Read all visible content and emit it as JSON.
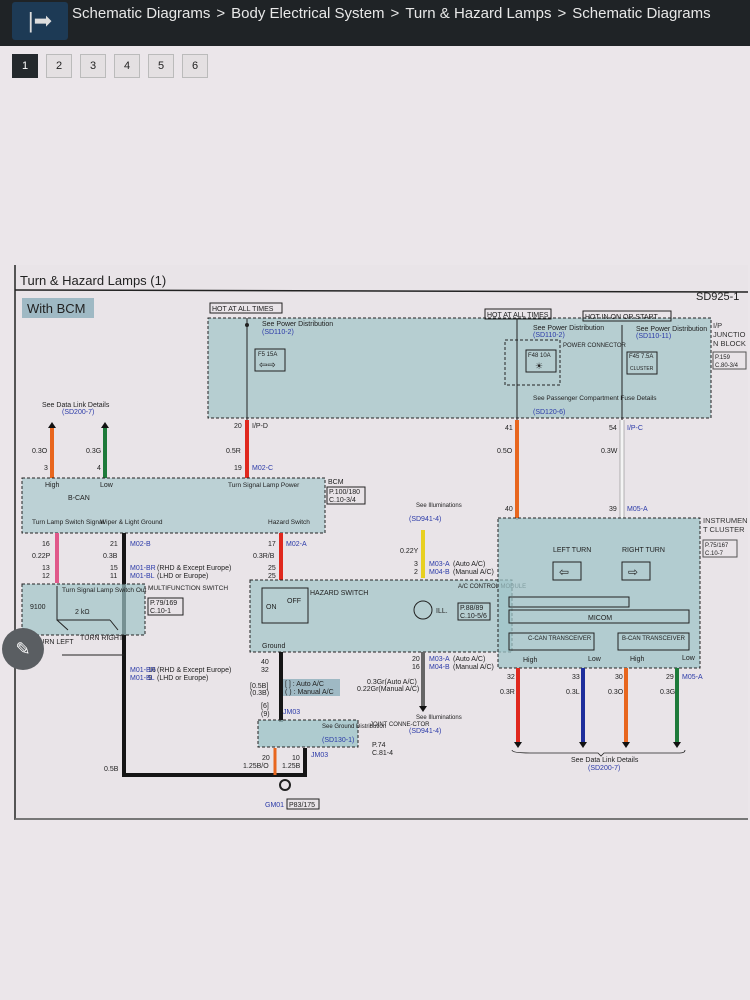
{
  "header": {
    "breadcrumbs": [
      "Schematic Diagrams",
      "Body Electrical System",
      "Turn & Hazard Lamps",
      "Schematic Diagrams"
    ],
    "separator": ">",
    "menu_icon": "arrow-right-bar-icon"
  },
  "pager": {
    "pages": [
      "1",
      "2",
      "3",
      "4",
      "5",
      "6"
    ],
    "active": "1"
  },
  "diagram": {
    "title": "Turn & Hazard Lamps (1)",
    "code": "SD925-1",
    "variant": "With BCM",
    "hot_all_times": "HOT AT ALL TIMES",
    "hot_on_start": "HOT IN ON OR START",
    "see_power_dist": "See Power Distribution",
    "sd110_2": "(SD110-2)",
    "sd110_11": "(SD110-11)",
    "fuse_f5": "F5 15A",
    "fuse_f48": "F48 10A",
    "fuse_f45": "F45 7.5A",
    "cluster_fuse_label": "CLUSTER",
    "power_connector": "POWER CONNECTOR",
    "see_passenger": "See Passenger Compartment Fuse Details",
    "sd120_6": "(SD120-6)",
    "ip_junction": "I/P JUNCTION BLOCK",
    "ip_junction_ref": [
      "P.159",
      "C.80-3/4"
    ],
    "see_data_link": "See Data Link Details",
    "sd200_7": "(SD200-7)",
    "wires": {
      "w_03o": "0.3O",
      "w_03g": "0.3G",
      "pin3": "3",
      "pin4": "4",
      "p20": "20",
      "ipd": "I/P-D",
      "w05r": "0.5R",
      "p19": "19",
      "m02c": "M02-C",
      "p41": "41",
      "w05o": "0.5O",
      "p54": "54",
      "ipc": "I/P-C",
      "w03w": "0.3W",
      "p40": "40",
      "p39": "39",
      "m05a": "M05-A",
      "p16": "16",
      "w022p": "0.22P",
      "p13": "13",
      "p12": "12",
      "p21": "21",
      "m02b": "M02-B",
      "w03b": "0.3B",
      "p15": "15",
      "p11": "11",
      "m01br": "M01-BR",
      "rhd": "(RHD & Except Europe)",
      "m01bl": "M01-BL",
      "lhd": "(LHD or Europe)",
      "p16b": "16",
      "p9": "9",
      "p17": "17",
      "m02a": "M02-A",
      "w03rb": "0.3R/B",
      "p25a": "25",
      "p25b": "25",
      "p40b": "40",
      "p32": "32",
      "w05b_br": "[0.5B]",
      "w03b_par": "(0.3B)",
      "legend_auto": "[ ] : Auto A/C",
      "legend_manual": "( ) : Manual A/C",
      "p6": "[6]",
      "p9b": "(9)",
      "jm03": "JM03",
      "p20b": "20",
      "w125bo": "1.25B/O",
      "p10": "10",
      "w125b": "1.25B",
      "jm03b": "JM03",
      "w05b": "0.5B",
      "w022y": "0.22Y",
      "p3": "3",
      "p2": "2",
      "m03a": "M03-A",
      "auto_ac": "(Auto A/C)",
      "m04b": "M04-B",
      "manual_ac": "(Manual A/C)",
      "p20c": "20",
      "p16c": "16",
      "w03gr": "0.3Gr(Auto A/C)",
      "w022gr": "0.22Gr(Manual A/C)",
      "p32b": "32",
      "w03r": "0.3R",
      "p33": "33",
      "w03l": "0.3L",
      "p30": "30",
      "w03o2": "0.3O",
      "p29": "29",
      "w03g2": "0.3G",
      "m05a2": "M05-A"
    },
    "bcm": {
      "name": "BCM",
      "ref": [
        "P.100/180",
        "C.10-3/4"
      ],
      "high": "High",
      "low": "Low",
      "bcan": "B-CAN",
      "turn_power": "Turn Signal Lamp Power",
      "turn_switch_signal": "Turn Lamp Switch Signal",
      "wiper_ground": "Wiper & Light Ground",
      "hazard_switch": "Hazard Switch"
    },
    "multifunction": {
      "name": "MULTIFUNCTION SWITCH",
      "ref": [
        "P.79/169",
        "C.10-1"
      ],
      "out": "Turn Signal Lamp Switch Out",
      "r1": "9100",
      "r2": "2 kΩ",
      "left": "TURN LEFT",
      "right": "TURN RIGHT"
    },
    "hazard": {
      "name": "HAZARD SWITCH",
      "on": "ON",
      "off": "OFF",
      "ground": "Ground"
    },
    "ac": {
      "see": "See Illuminations",
      "sd": "(SD941-4)",
      "name": "A/C CONTROL MODULE",
      "ref": [
        "P.88/89",
        "C.10-5/6"
      ],
      "ill": "ILL."
    },
    "joint": {
      "see": "See Ground Distribution",
      "sd": "(SD130-1)",
      "name": "JOINT CONNE-CTOR",
      "ref": [
        "P.74",
        "C.81-4"
      ]
    },
    "ground": {
      "name": "GM01",
      "ref": "P83/175"
    },
    "cluster": {
      "name": "INSTRUMENT CLUSTER",
      "ref": [
        "P.75/167",
        "C.10-7"
      ],
      "left": "LEFT TURN",
      "right": "RIGHT TURN",
      "micom": "MICOM",
      "ccan": "C-CAN TRANSCEIVER",
      "bcan": "B-CAN TRANSCEIVER",
      "high": "High",
      "low": "Low"
    },
    "colors": {
      "red": "#e0281e",
      "orange": "#e8661e",
      "green": "#1d7a3a",
      "blue": "#1e2e9c",
      "pink": "#e0588a",
      "black": "#151515",
      "yellow": "#e8d020",
      "gray": "#666666",
      "white": "#f4f4f4",
      "box_fill": "#9fc4c8"
    }
  }
}
